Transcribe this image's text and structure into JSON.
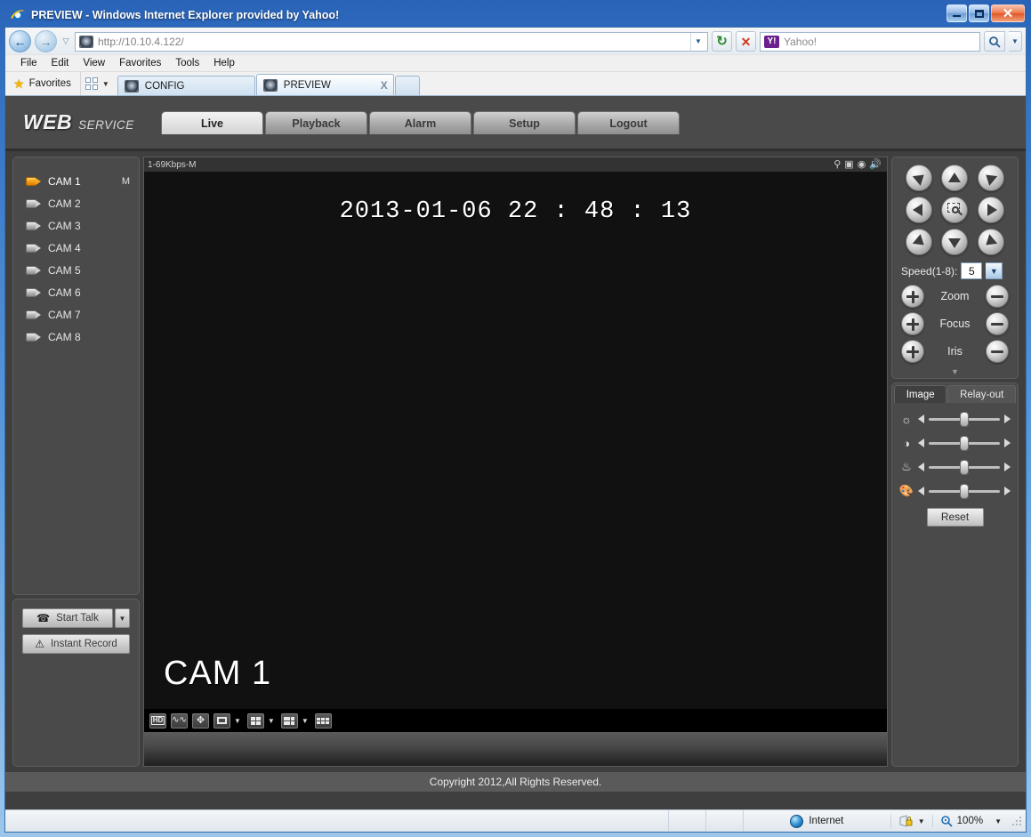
{
  "window": {
    "title": "PREVIEW - Windows Internet Explorer provided by Yahoo!",
    "minimize_label": "Minimize",
    "maximize_label": "Maximize",
    "close_label": "✕"
  },
  "browser": {
    "back_label": "←",
    "forward_label": "→",
    "history_caret": "▽",
    "address": "http://10.10.4.122/",
    "address_caret": "▼",
    "refresh_label": "↻",
    "stop_label": "✕",
    "search": {
      "provider": "Y!",
      "placeholder": "Yahoo!",
      "go_label": "⚲",
      "caret": "▼"
    },
    "menu": [
      "File",
      "Edit",
      "View",
      "Favorites",
      "Tools",
      "Help"
    ],
    "favorites_label": "Favorites",
    "tabs": [
      {
        "label": "CONFIG",
        "active": false,
        "close": ""
      },
      {
        "label": "PREVIEW",
        "active": true,
        "close": "X"
      }
    ]
  },
  "app": {
    "brand_web": "WEB",
    "brand_service": "SERVICE",
    "nav": [
      {
        "label": "Live",
        "active": true
      },
      {
        "label": "Playback",
        "active": false
      },
      {
        "label": "Alarm",
        "active": false
      },
      {
        "label": "Setup",
        "active": false
      },
      {
        "label": "Logout",
        "active": false
      }
    ],
    "copyright": "Copyright 2012,All Rights Reserved."
  },
  "cameras": [
    {
      "name": "CAM 1",
      "active": true,
      "mark": "M"
    },
    {
      "name": "CAM 2",
      "active": false,
      "mark": ""
    },
    {
      "name": "CAM 3",
      "active": false,
      "mark": ""
    },
    {
      "name": "CAM 4",
      "active": false,
      "mark": ""
    },
    {
      "name": "CAM 5",
      "active": false,
      "mark": ""
    },
    {
      "name": "CAM 6",
      "active": false,
      "mark": ""
    },
    {
      "name": "CAM 7",
      "active": false,
      "mark": ""
    },
    {
      "name": "CAM 8",
      "active": false,
      "mark": ""
    }
  ],
  "left_buttons": {
    "start_talk": "Start Talk",
    "start_talk_caret": "▼",
    "instant_record": "Instant Record",
    "talk_icon": "☎",
    "record_icon": "⚠"
  },
  "video": {
    "stream_info": "1-69Kbps-M",
    "osd_time": "2013-01-06  22 : 48 : 13",
    "osd_channel": "CAM 1",
    "head_icons": [
      "digital-zoom-icon",
      "local-record-icon",
      "snapshot-icon",
      "audio-icon"
    ],
    "toolbar": [
      {
        "name": "quality-hd",
        "label": "HD",
        "caret": false
      },
      {
        "name": "fluency",
        "label": "",
        "caret": false
      },
      {
        "name": "full-screen",
        "label": "",
        "caret": false
      },
      {
        "name": "window-1",
        "label": "",
        "caret": true
      },
      {
        "name": "window-4",
        "label": "",
        "caret": true
      },
      {
        "name": "window-6",
        "label": "",
        "caret": true
      },
      {
        "name": "window-9",
        "label": "",
        "caret": false
      }
    ]
  },
  "ptz": {
    "speed_label": "Speed(1-8):",
    "speed_value": "5",
    "speed_caret": "▼",
    "zoom_label": "Zoom",
    "focus_label": "Focus",
    "iris_label": "Iris",
    "collapse_caret": "▼",
    "directions": [
      "up-left",
      "up",
      "up-right",
      "left",
      "center-zoom",
      "right",
      "down-left",
      "down",
      "down-right"
    ]
  },
  "image_panel": {
    "tabs": [
      {
        "label": "Image",
        "active": true
      },
      {
        "label": "Relay-out",
        "active": false
      }
    ],
    "sliders": [
      {
        "name": "brightness",
        "icon": "☼",
        "value": 50
      },
      {
        "name": "contrast",
        "icon": "◑",
        "value": 50
      },
      {
        "name": "hue",
        "icon": "☂",
        "value": 50
      },
      {
        "name": "saturation",
        "icon": "❁",
        "value": 50
      }
    ],
    "reset_label": "Reset",
    "arrow_left": "◀",
    "arrow_right": "▶"
  },
  "statusbar": {
    "zone": "Internet",
    "protected_caret": "▼",
    "zoom_level": "100%",
    "zoom_caret": "▼"
  },
  "colors": {
    "accent_orange": "#f5a81c",
    "panel_bg": "#4a4a4a",
    "page_bg": "#3f3f3f",
    "video_bg": "#111111",
    "title_blue": "#2f6dc0"
  }
}
